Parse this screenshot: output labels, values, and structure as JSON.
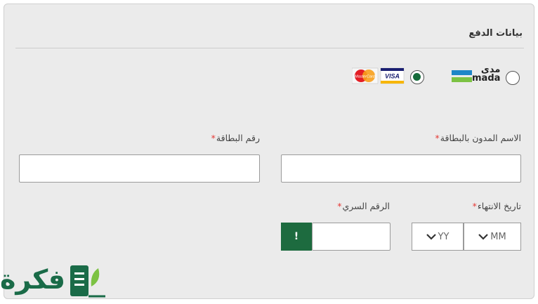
{
  "section": {
    "title": "بيانات الدفع"
  },
  "payment_methods": [
    {
      "name": "mada",
      "logo_ar": "مدى",
      "logo_en": "mada",
      "selected": false
    },
    {
      "name": "visa-mastercard",
      "visa_text": "VISA",
      "mastercard_text": "MasterCard",
      "selected": true
    }
  ],
  "fields": {
    "cardholder_name": {
      "label": "الاسم المدون بالبطاقة",
      "required_mark": "*",
      "value": ""
    },
    "card_number": {
      "label": "رقم البطاقة",
      "required_mark": "*",
      "value": ""
    },
    "expiry": {
      "label": "تاريخ الانتهاء",
      "required_mark": "*",
      "month_placeholder": "MM",
      "year_placeholder": "YY"
    },
    "cvv": {
      "label": "الرقم السري",
      "required_mark": "*",
      "value": "",
      "info_button": "!"
    }
  },
  "watermark": {
    "text": "فكرة"
  },
  "colors": {
    "accent": "#1d6b3f",
    "required": "#e53935",
    "mada_blue": "#1e86c7",
    "mada_green": "#7cc243"
  }
}
